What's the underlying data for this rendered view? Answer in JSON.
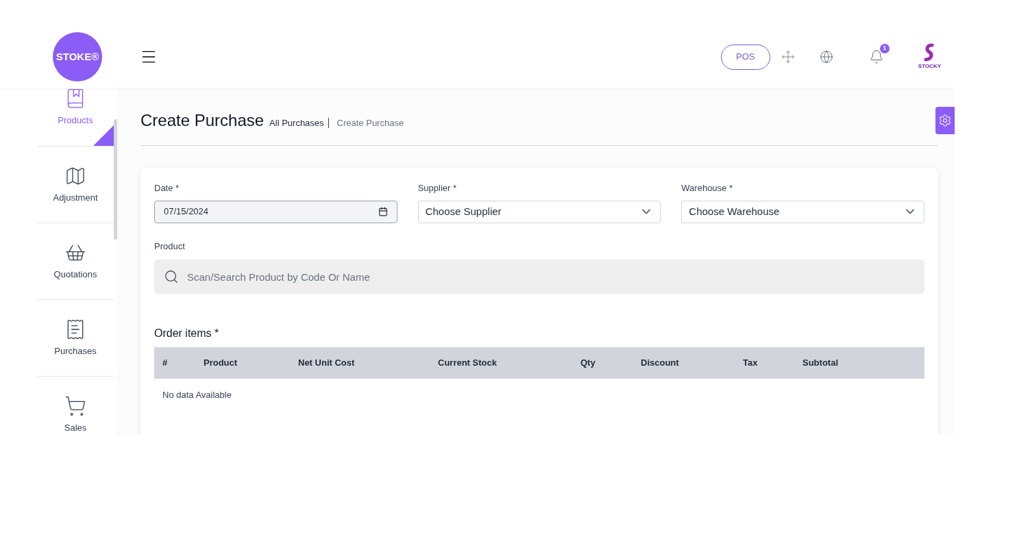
{
  "header": {
    "logo": "STOKE®",
    "pos_button": "POS",
    "notifications": "1",
    "brand": "STOCKY"
  },
  "sidebar": {
    "items": [
      {
        "label": "Products",
        "selected": true
      },
      {
        "label": "Adjustment",
        "selected": false
      },
      {
        "label": "Quotations",
        "selected": false
      },
      {
        "label": "Purchases",
        "selected": false
      },
      {
        "label": "Sales",
        "selected": false
      }
    ]
  },
  "page": {
    "title": "Create Purchase",
    "breadcrumbs": [
      "All Purchases",
      "Create Purchase"
    ]
  },
  "form": {
    "date": {
      "label": "Date *",
      "value": "07/15/2024"
    },
    "supplier": {
      "label": "Supplier *",
      "placeholder": "Choose Supplier"
    },
    "warehouse": {
      "label": "Warehouse *",
      "placeholder": "Choose Warehouse"
    },
    "product": {
      "label": "Product",
      "placeholder": "Scan/Search Product by Code Or Name"
    }
  },
  "order_items": {
    "title": "Order items *",
    "columns": [
      "#",
      "Product",
      "Net Unit Cost",
      "Current Stock",
      "Qty",
      "Discount",
      "Tax",
      "Subtotal"
    ],
    "empty_text": "No data Available"
  }
}
